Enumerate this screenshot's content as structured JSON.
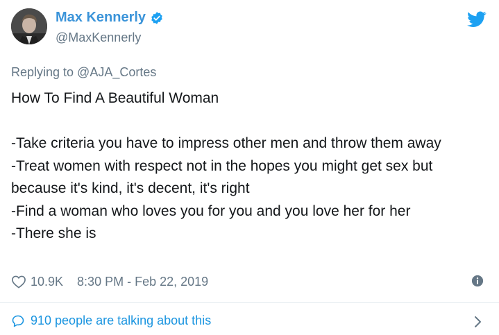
{
  "author": {
    "display_name": "Max Kennerly",
    "handle": "@MaxKennerly",
    "verified": true
  },
  "reply": {
    "replying_to": "Replying to @AJA_Cortes"
  },
  "tweet": {
    "lines": [
      "How To Find A Beautiful Woman",
      "",
      "-Take criteria you have to impress other men and throw them away",
      "-Treat women with respect not in the hopes you might get sex but because it's kind, it's decent, it's right",
      "-Find a woman who loves you for you and you love her for her",
      "-There she is"
    ]
  },
  "meta": {
    "likes": "10.9K",
    "timestamp": "8:30 PM - Feb 22, 2019"
  },
  "footer": {
    "talking_text": "910 people are talking about this"
  },
  "icons": {
    "brand": "twitter-bird-icon",
    "verified": "verified-badge-icon",
    "like": "heart-icon",
    "info": "info-icon",
    "reply": "comment-bubble-icon",
    "more": "chevron-right-icon"
  },
  "colors": {
    "brand_blue": "#1da1f2",
    "name_blue": "#3b94d9",
    "link_blue": "#1b95e0",
    "muted": "#657786",
    "text": "#14171a"
  }
}
